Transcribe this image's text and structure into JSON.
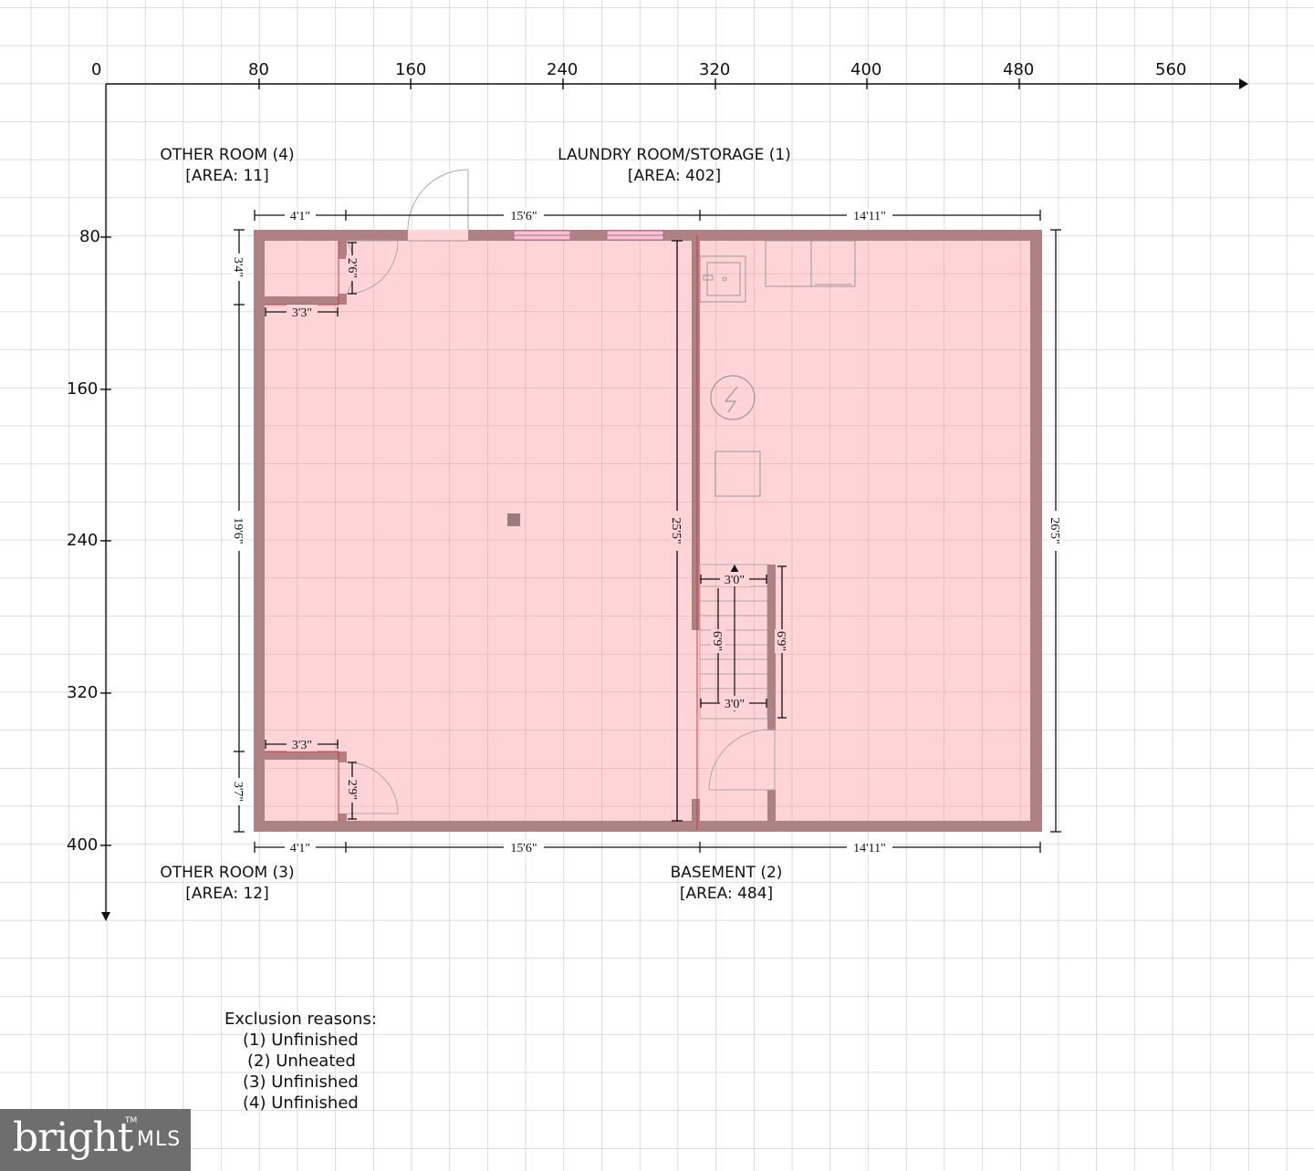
{
  "axes": {
    "x_ticks": [
      "0",
      "80",
      "160",
      "240",
      "320",
      "400",
      "480",
      "560"
    ],
    "y_ticks": [
      "80",
      "160",
      "240",
      "320",
      "400"
    ]
  },
  "rooms": {
    "other_room_4": {
      "name": "OTHER ROOM (4)",
      "area": "[AREA: 11]"
    },
    "laundry": {
      "name": "LAUNDRY ROOM/STORAGE (1)",
      "area": "[AREA: 402]"
    },
    "other_room_3": {
      "name": "OTHER ROOM (3)",
      "area": "[AREA: 12]"
    },
    "basement": {
      "name": "BASEMENT (2)",
      "area": "[AREA: 484]"
    }
  },
  "dimensions": {
    "top_a": "4'1\"",
    "top_b": "15'6\"",
    "top_c": "14'11\"",
    "bottom_a": "4'1\"",
    "bottom_b": "15'6\"",
    "bottom_c": "14'11\"",
    "left_top": "3'4\"",
    "left_mid": "19'6\"",
    "left_bottom": "3'7\"",
    "right": "26'5\"",
    "inner_vertical": "25'5\"",
    "closet_top_width": "3'3\"",
    "closet_top_door": "2'6\"",
    "closet_bottom_width": "3'3\"",
    "closet_bottom_door": "2'9\"",
    "stair_top_width": "3'0\"",
    "stair_bottom_width": "3'0\"",
    "stair_length_inner": "6'9\"",
    "stair_length_outer": "6'9\""
  },
  "legend": {
    "title": "Exclusion reasons:",
    "items": [
      "(1) Unfinished",
      "(2) Unheated",
      "(3) Unfinished",
      "(4) Unfinished"
    ]
  },
  "logo": {
    "word": "bright",
    "suffix": "MLS",
    "mark": "TM"
  },
  "colors": {
    "room_fill": "#ffd4d6",
    "wall": "#ae8282",
    "grid": "#c9c9c9",
    "accent_line": "#e0303a"
  },
  "icons": [
    "arrow-right-icon",
    "arrow-down-icon",
    "electric-panel-icon",
    "sink-icon",
    "stair-arrow-icon"
  ]
}
